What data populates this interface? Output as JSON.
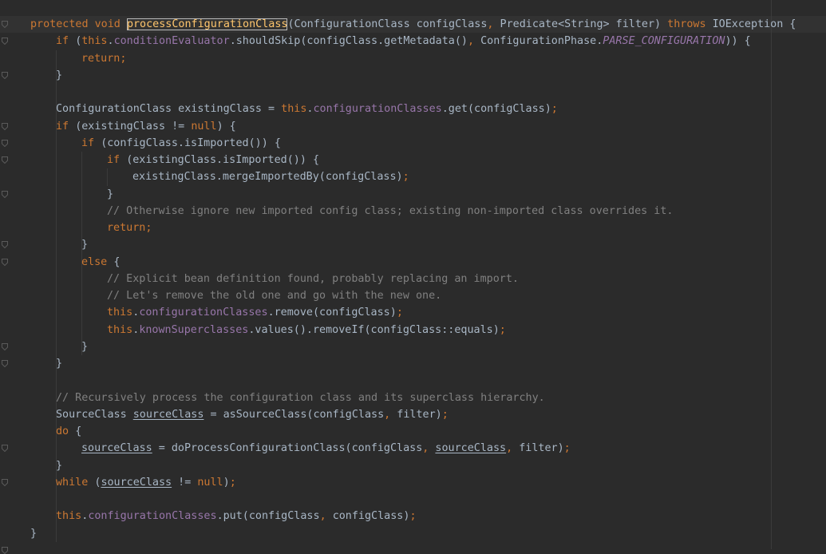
{
  "editor": {
    "language": "java",
    "colors": {
      "background": "#2b2b2b",
      "text": "#a9b7c6",
      "keyword": "#cc7832",
      "method_declaration": "#ffc66d",
      "field": "#9876aa",
      "comment": "#808080"
    },
    "lines": [
      {
        "indent": 0,
        "tokens": [
          {
            "t": "protected void ",
            "c": "kw"
          },
          {
            "t": "processConfigurationClass",
            "c": "fn caret-hl"
          },
          {
            "t": "(ConfigurationClass configClass"
          },
          {
            "t": ", ",
            "c": "kw"
          },
          {
            "t": "Predicate<String> filter) "
          },
          {
            "t": "throws ",
            "c": "kw"
          },
          {
            "t": "IOException {"
          }
        ]
      },
      {
        "indent": 1,
        "tokens": [
          {
            "t": "if ",
            "c": "kw"
          },
          {
            "t": "("
          },
          {
            "t": "this",
            "c": "kw"
          },
          {
            "t": "."
          },
          {
            "t": "conditionEvaluator",
            "c": "fld"
          },
          {
            "t": ".shouldSkip(configClass.getMetadata()"
          },
          {
            "t": ", ",
            "c": "kw"
          },
          {
            "t": "ConfigurationPhase."
          },
          {
            "t": "PARSE_CONFIGURATION",
            "c": "cst"
          },
          {
            "t": ")) {"
          }
        ]
      },
      {
        "indent": 2,
        "tokens": [
          {
            "t": "return;",
            "c": "kw"
          }
        ]
      },
      {
        "indent": 1,
        "tokens": [
          {
            "t": "}"
          }
        ]
      },
      {
        "indent": 0,
        "tokens": []
      },
      {
        "indent": 1,
        "tokens": [
          {
            "t": "ConfigurationClass existingClass = "
          },
          {
            "t": "this",
            "c": "kw"
          },
          {
            "t": "."
          },
          {
            "t": "configurationClasses",
            "c": "fld"
          },
          {
            "t": ".get(configClass)"
          },
          {
            "t": ";",
            "c": "kw"
          }
        ]
      },
      {
        "indent": 1,
        "tokens": [
          {
            "t": "if ",
            "c": "kw"
          },
          {
            "t": "(existingClass != "
          },
          {
            "t": "null",
            "c": "kw"
          },
          {
            "t": ") {"
          }
        ]
      },
      {
        "indent": 2,
        "tokens": [
          {
            "t": "if ",
            "c": "kw"
          },
          {
            "t": "(configClass.isImported()) {"
          }
        ]
      },
      {
        "indent": 3,
        "tokens": [
          {
            "t": "if ",
            "c": "kw"
          },
          {
            "t": "(existingClass.isImported()) {"
          }
        ]
      },
      {
        "indent": 4,
        "tokens": [
          {
            "t": "existingClass.mergeImportedBy(configClass)"
          },
          {
            "t": ";",
            "c": "kw"
          }
        ]
      },
      {
        "indent": 3,
        "tokens": [
          {
            "t": "}"
          }
        ]
      },
      {
        "indent": 3,
        "tokens": [
          {
            "t": "// Otherwise ignore new imported config class; existing non-imported class overrides it.",
            "c": "cm"
          }
        ]
      },
      {
        "indent": 3,
        "tokens": [
          {
            "t": "return;",
            "c": "kw"
          }
        ]
      },
      {
        "indent": 2,
        "tokens": [
          {
            "t": "}"
          }
        ]
      },
      {
        "indent": 2,
        "tokens": [
          {
            "t": "else ",
            "c": "kw"
          },
          {
            "t": "{"
          }
        ]
      },
      {
        "indent": 3,
        "tokens": [
          {
            "t": "// Explicit bean definition found, probably replacing an import.",
            "c": "cm"
          }
        ]
      },
      {
        "indent": 3,
        "tokens": [
          {
            "t": "// Let's remove the old one and go with the new one.",
            "c": "cm"
          }
        ]
      },
      {
        "indent": 3,
        "tokens": [
          {
            "t": "this",
            "c": "kw"
          },
          {
            "t": "."
          },
          {
            "t": "configurationClasses",
            "c": "fld"
          },
          {
            "t": ".remove(configClass)"
          },
          {
            "t": ";",
            "c": "kw"
          }
        ]
      },
      {
        "indent": 3,
        "tokens": [
          {
            "t": "this",
            "c": "kw"
          },
          {
            "t": "."
          },
          {
            "t": "knownSuperclasses",
            "c": "fld"
          },
          {
            "t": ".values().removeIf(configClass::equals)"
          },
          {
            "t": ";",
            "c": "kw"
          }
        ]
      },
      {
        "indent": 2,
        "tokens": [
          {
            "t": "}"
          }
        ]
      },
      {
        "indent": 1,
        "tokens": [
          {
            "t": "}"
          }
        ]
      },
      {
        "indent": 0,
        "tokens": []
      },
      {
        "indent": 1,
        "tokens": [
          {
            "t": "// Recursively process the configuration class and its superclass hierarchy.",
            "c": "cm"
          }
        ]
      },
      {
        "indent": 1,
        "tokens": [
          {
            "t": "SourceClass "
          },
          {
            "t": "sourceClass",
            "c": "u"
          },
          {
            "t": " = asSourceClass(configClass"
          },
          {
            "t": ", ",
            "c": "kw"
          },
          {
            "t": "filter)"
          },
          {
            "t": ";",
            "c": "kw"
          }
        ]
      },
      {
        "indent": 1,
        "tokens": [
          {
            "t": "do ",
            "c": "kw"
          },
          {
            "t": "{"
          }
        ]
      },
      {
        "indent": 2,
        "tokens": [
          {
            "t": "sourceClass",
            "c": "u"
          },
          {
            "t": " = doProcessConfigurationClass(configClass"
          },
          {
            "t": ", ",
            "c": "kw"
          },
          {
            "t": "sourceClass",
            "c": "u"
          },
          {
            "t": ", ",
            "c": "kw"
          },
          {
            "t": "filter)"
          },
          {
            "t": ";",
            "c": "kw"
          }
        ]
      },
      {
        "indent": 1,
        "tokens": [
          {
            "t": "}"
          }
        ]
      },
      {
        "indent": 1,
        "tokens": [
          {
            "t": "while ",
            "c": "kw"
          },
          {
            "t": "("
          },
          {
            "t": "sourceClass",
            "c": "u"
          },
          {
            "t": " != "
          },
          {
            "t": "null",
            "c": "kw"
          },
          {
            "t": ")"
          },
          {
            "t": ";",
            "c": "kw"
          }
        ]
      },
      {
        "indent": 0,
        "tokens": []
      },
      {
        "indent": 1,
        "tokens": [
          {
            "t": "this",
            "c": "kw"
          },
          {
            "t": "."
          },
          {
            "t": "configurationClasses",
            "c": "fld"
          },
          {
            "t": ".put(configClass"
          },
          {
            "t": ", ",
            "c": "kw"
          },
          {
            "t": "configClass)"
          },
          {
            "t": ";",
            "c": "kw"
          }
        ]
      },
      {
        "indent": 0,
        "tokens": [
          {
            "t": "}"
          }
        ]
      }
    ]
  }
}
